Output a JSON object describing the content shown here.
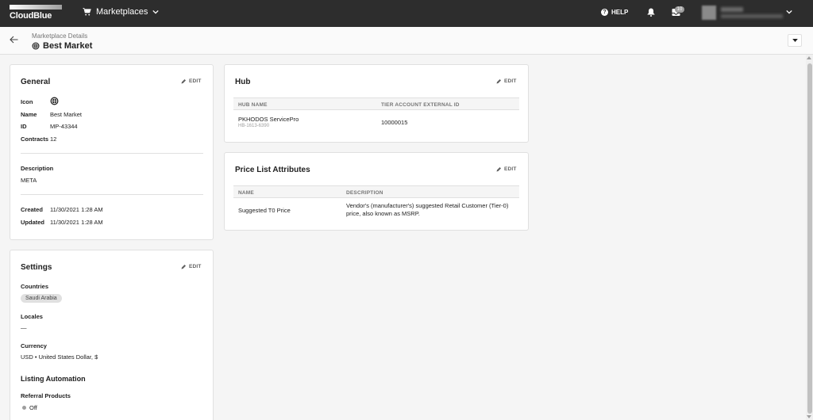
{
  "app": {
    "logo_text": "CloudBlue"
  },
  "topbar": {
    "nav_label": "Marketplaces",
    "help_label": "HELP",
    "inbox_count": "10",
    "icons": [
      "cart-icon",
      "chevron-down-icon",
      "help-icon",
      "bell-icon",
      "inbox-icon"
    ]
  },
  "header": {
    "breadcrumb": "Marketplace Details",
    "title": "Best Market"
  },
  "general": {
    "title": "General",
    "edit": "EDIT",
    "icon_label": "Icon",
    "name_label": "Name",
    "name_value": "Best Market",
    "id_label": "ID",
    "id_value": "MP-43344",
    "contracts_label": "Contracts",
    "contracts_value": "12",
    "description_label": "Description",
    "description_value": "META",
    "created_label": "Created",
    "created_value": "11/30/2021 1:28 AM",
    "updated_label": "Updated",
    "updated_value": "11/30/2021 1:28 AM"
  },
  "settings": {
    "title": "Settings",
    "edit": "EDIT",
    "countries_label": "Countries",
    "country_chip": "Saudi Arabia",
    "locales_label": "Locales",
    "locales_value": "—",
    "currency_label": "Currency",
    "currency_value": "USD • United States Dollar, $",
    "listing_title": "Listing Automation",
    "referral_label": "Referral Products",
    "referral_value": "Off"
  },
  "hub": {
    "title": "Hub",
    "edit": "EDIT",
    "col_name": "HUB NAME",
    "col_tier": "TIER ACCOUNT EXTERNAL ID",
    "row_name": "PKHODOS ServicePro",
    "row_id": "HB-1613-6390",
    "row_tier": "10000015"
  },
  "price_list": {
    "title": "Price List Attributes",
    "edit": "EDIT",
    "col_name": "NAME",
    "col_desc": "DESCRIPTION",
    "row_name": "Suggested T0 Price",
    "row_desc_1": "Vendor's (manufacturer's) suggested Retail Customer (Tier-0)",
    "row_desc_2": "price, also known as MSRP."
  },
  "colors": {
    "topbar": "#2d2d2d",
    "background": "#f5f5f5",
    "card": "#ffffff"
  }
}
